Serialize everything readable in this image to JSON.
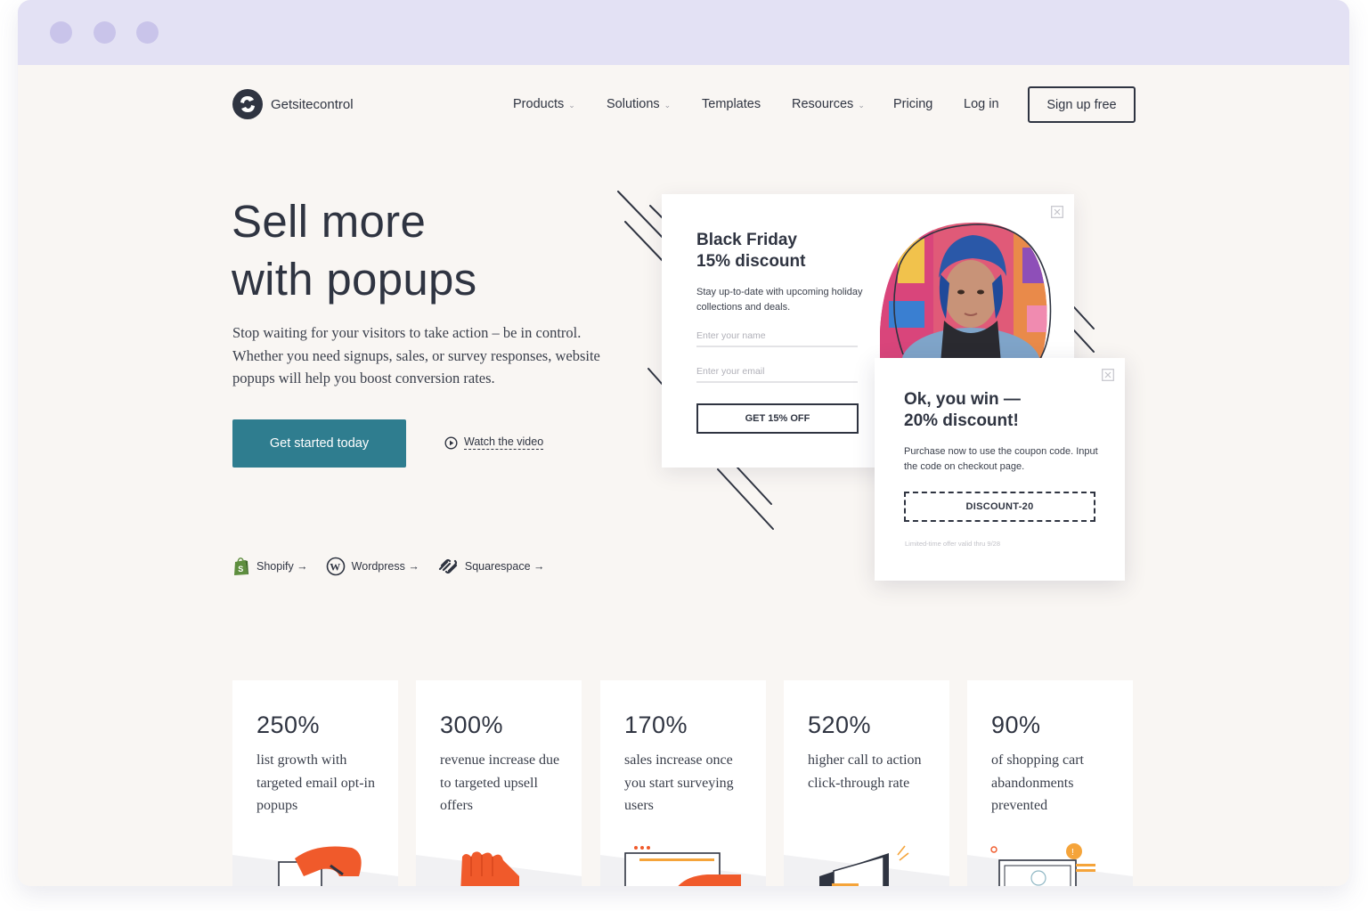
{
  "window": {
    "dots": 3
  },
  "header": {
    "brand": "Getsitecontrol",
    "nav": [
      {
        "label": "Products",
        "dropdown": true
      },
      {
        "label": "Solutions",
        "dropdown": true
      },
      {
        "label": "Templates",
        "dropdown": false
      },
      {
        "label": "Resources",
        "dropdown": true
      },
      {
        "label": "Pricing",
        "dropdown": false
      },
      {
        "label": "Log in",
        "dropdown": false
      }
    ],
    "signup_label": "Sign up free"
  },
  "hero": {
    "title_line1": "Sell more",
    "title_line2": "with popups",
    "subtitle": "Stop waiting for your visitors to take action – be in control. Whether you need signups, sales, or survey responses, website popups will help you boost conversion rates.",
    "cta_label": "Get started today",
    "watch_label": "Watch the video",
    "integrations": [
      {
        "label": "Shopify →",
        "icon": "shopify-icon"
      },
      {
        "label": "Wordpress →",
        "icon": "wordpress-icon"
      },
      {
        "label": "Squarespace →",
        "icon": "squarespace-icon"
      }
    ]
  },
  "popup_black_friday": {
    "title_line1": "Black Friday",
    "title_line2": "15% discount",
    "text": "Stay up-to-date with upcoming holiday collections and deals.",
    "name_placeholder": "Enter your name",
    "email_placeholder": "Enter your email",
    "button_label": "GET 15% OFF"
  },
  "popup_win": {
    "title_line1": "Ok, you win —",
    "title_line2": "20% discount!",
    "text": "Purchase now to use the coupon code. Input the code on checkout page.",
    "coupon": "DISCOUNT-20",
    "fine_print": "Limited-time offer valid thru 9/28"
  },
  "stats": [
    {
      "value": "250%",
      "desc": "list growth with targeted email opt-in popups"
    },
    {
      "value": "300%",
      "desc": "revenue increase due to targeted upsell offers"
    },
    {
      "value": "170%",
      "desc": "sales increase once you start surveying users"
    },
    {
      "value": "520%",
      "desc": "higher call to action click-through rate"
    },
    {
      "value": "90%",
      "desc": "of shopping cart abandonments prevented"
    }
  ],
  "colors": {
    "primary": "#2f7d8f",
    "text": "#2f3441",
    "background": "#f9f6f3",
    "titlebar": "#e3e1f4",
    "accent": "#f05a2b"
  }
}
